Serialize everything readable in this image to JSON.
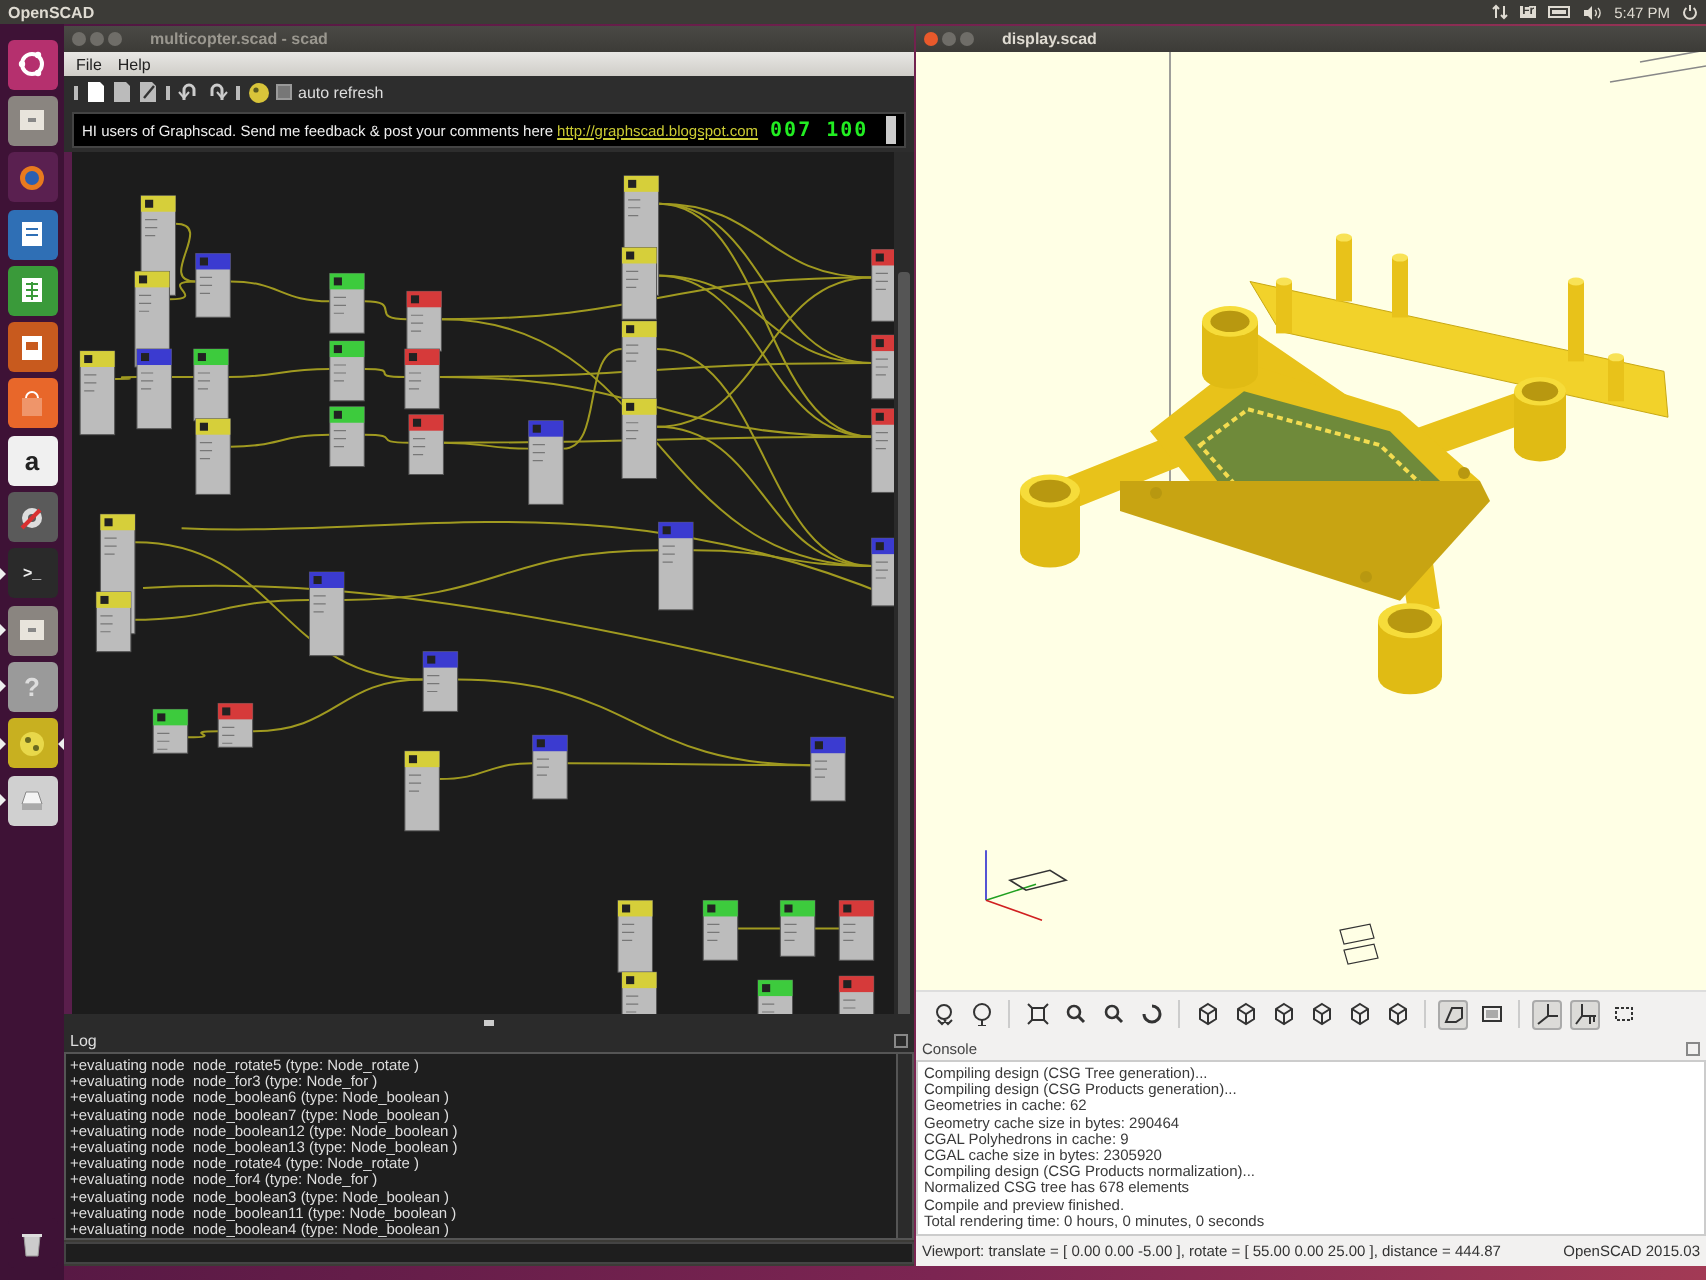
{
  "top_panel": {
    "app_name": "OpenSCAD",
    "keyboard": "Fr",
    "clock": "5:47 PM"
  },
  "launcher": [
    {
      "kind": "ubuntu",
      "running": false,
      "focused": false
    },
    {
      "kind": "files",
      "running": false,
      "focused": false
    },
    {
      "kind": "browser",
      "running": false,
      "focused": false
    },
    {
      "kind": "writer",
      "running": false,
      "focused": false
    },
    {
      "kind": "calc",
      "running": false,
      "focused": false
    },
    {
      "kind": "impress",
      "running": false,
      "focused": false
    },
    {
      "kind": "software",
      "running": false,
      "focused": false
    },
    {
      "kind": "amazon",
      "glyph": "a",
      "running": false,
      "focused": false
    },
    {
      "kind": "settings",
      "running": false,
      "focused": false
    },
    {
      "kind": "terminal",
      "glyph": ">_",
      "running": true,
      "focused": false
    },
    {
      "kind": "files",
      "running": true,
      "focused": false
    },
    {
      "kind": "help",
      "glyph": "?",
      "running": true,
      "focused": false
    },
    {
      "kind": "openscad",
      "running": true,
      "focused": true
    },
    {
      "kind": "disk",
      "running": true,
      "focused": false
    },
    {
      "kind": "trash",
      "running": false,
      "focused": false
    }
  ],
  "graph_window": {
    "title": "multicopter.scad - scad",
    "active": false,
    "menu": [
      "File",
      "Help"
    ],
    "auto_refresh": {
      "label": "auto refresh",
      "checked": false
    },
    "banner": {
      "message": "HI users of Graphscad. Send me feedback & post your comments here",
      "link": "http://graphscad.blogspot.com",
      "counter": "007 100"
    },
    "log": {
      "title": "Log",
      "lines": [
        "+evaluating node  node_rotate5 (type: Node_rotate )",
        "+evaluating node  node_for3 (type: Node_for )",
        "+evaluating node  node_boolean6 (type: Node_boolean )",
        "+evaluating node  node_boolean7 (type: Node_boolean )",
        "+evaluating node  node_boolean12 (type: Node_boolean )",
        "+evaluating node  node_boolean13 (type: Node_boolean )",
        "+evaluating node  node_rotate4 (type: Node_rotate )",
        "+evaluating node  node_for4 (type: Node_for )",
        "+evaluating node  node_boolean3 (type: Node_boolean )",
        "+evaluating node  node_boolean11 (type: Node_boolean )",
        "+evaluating node  node_boolean4 (type: Node_boolean )"
      ]
    }
  },
  "display_window": {
    "title": "display.scad",
    "active": true,
    "view_toolbar": [
      {
        "kind": "preview",
        "pressed": false
      },
      {
        "kind": "render",
        "pressed": false
      },
      {
        "kind": "view-all",
        "pressed": false
      },
      {
        "kind": "zoom-in",
        "pressed": false
      },
      {
        "kind": "zoom-out",
        "pressed": false
      },
      {
        "kind": "reset",
        "pressed": false
      },
      {
        "kind": "cube",
        "pressed": false
      },
      {
        "kind": "cube",
        "pressed": false
      },
      {
        "kind": "cube",
        "pressed": false
      },
      {
        "kind": "cube",
        "pressed": false
      },
      {
        "kind": "cube",
        "pressed": false
      },
      {
        "kind": "cube",
        "pressed": false
      },
      {
        "kind": "perspective",
        "pressed": true
      },
      {
        "kind": "orthogonal",
        "pressed": false
      },
      {
        "kind": "axes",
        "pressed": true
      },
      {
        "kind": "scale",
        "pressed": true
      },
      {
        "kind": "edges",
        "pressed": false
      }
    ],
    "console": {
      "title": "Console",
      "lines": [
        "Compiling design (CSG Tree generation)...",
        "Compiling design (CSG Products generation)...",
        "Geometries in cache: 62",
        "Geometry cache size in bytes: 290464",
        "CGAL Polyhedrons in cache: 9",
        "CGAL cache size in bytes: 2305920",
        "Compiling design (CSG Products normalization)...",
        "Normalized CSG tree has 678 elements",
        "Compile and preview finished.",
        "Total rendering time: 0 hours, 0 minutes, 0 seconds"
      ]
    },
    "status_bar": {
      "viewport": "Viewport: translate = [ 0.00 0.00 -5.00 ], rotate = [ 55.00 0.00 25.00 ], distance = 444.87",
      "version": "OpenSCAD 2015.03"
    }
  }
}
